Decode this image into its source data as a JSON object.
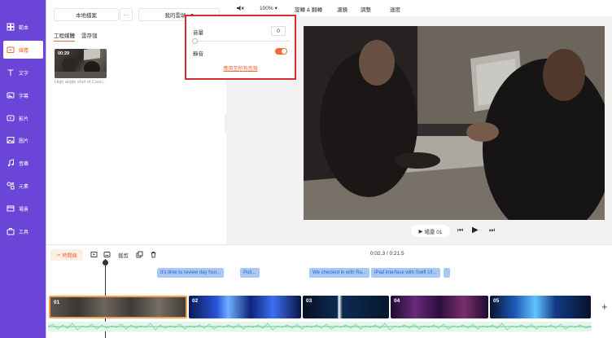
{
  "sidebar": {
    "items": [
      {
        "label": "範本",
        "icon": "template-icon"
      },
      {
        "label": "媒體",
        "icon": "media-icon",
        "active": true
      },
      {
        "label": "文字",
        "icon": "text-icon"
      },
      {
        "label": "字幕",
        "icon": "subtitle-icon"
      },
      {
        "label": "影片",
        "icon": "video-icon"
      },
      {
        "label": "圖片",
        "icon": "image-icon"
      },
      {
        "label": "音樂",
        "icon": "music-icon"
      },
      {
        "label": "元素",
        "icon": "elements-icon"
      },
      {
        "label": "場景",
        "icon": "scenes-icon"
      },
      {
        "label": "工具",
        "icon": "tools-icon"
      }
    ]
  },
  "media_panel": {
    "local_files_label": "本地檔案",
    "more_label": "···",
    "my_space_label": "我的雲端",
    "tabs": [
      "工程媒體",
      "雲存儲"
    ],
    "thumb_duration": "00:29",
    "thumb_caption": "High angle shot of Cauc..."
  },
  "toolbar": {
    "zoom": "100%",
    "rotate_flip": "旋轉 & 翻轉",
    "filter": "濾鏡",
    "adjust": "調整",
    "speed": "速度"
  },
  "volume_popover": {
    "volume_label": "音量",
    "volume_value": "0",
    "mute_label": "靜音",
    "mute_on": true,
    "apply_all": "應用至所有音頻"
  },
  "preview": {
    "scene_label": "場景 01"
  },
  "timeline": {
    "split_label": "時間線",
    "crop_label": "裁剪",
    "time": "0:02.3 / 0:21.5",
    "captions": [
      "It's time to review day four...",
      "Pull...",
      "We checked in with Ra...",
      "iPad interface with Swift UI..."
    ],
    "clips": [
      "01",
      "02",
      "03",
      "04",
      "05"
    ]
  },
  "colors": {
    "sidebar": "#6b44d8",
    "accent": "#f06a35",
    "highlight_box": "#d62d2d"
  }
}
